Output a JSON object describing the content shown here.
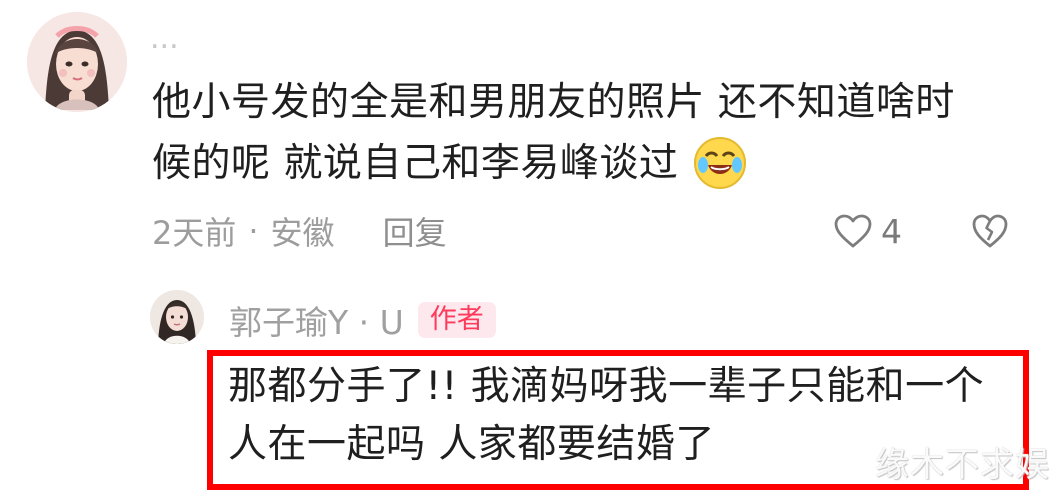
{
  "comment": {
    "username": "...",
    "text_lines": [
      "他小号发的全是和男朋友的照片 还不知道啥时",
      "候的呢 就说自己和李易峰谈过"
    ],
    "time": "2天前",
    "separator": "·",
    "location": "安徽",
    "reply_label": "回复",
    "like_count": "4",
    "icons": {
      "avatar": "avatar-portrait",
      "emoji": "crying-laughing-emoji",
      "like": "heart-outline-icon",
      "dislike": "broken-heart-icon"
    }
  },
  "reply": {
    "author": "郭子瑜Y · U",
    "badge": "作者",
    "text_lines": [
      "那都分手了!! 我滴妈呀我一辈子只能和一个",
      "人在一起吗 人家都要结婚了"
    ]
  },
  "watermark": "缘木不求娱",
  "colors": {
    "highlight": "#ff0000",
    "badge_bg": "#fde8ed",
    "badge_text": "#ff3b5c",
    "meta_text": "#9d9d9d"
  }
}
